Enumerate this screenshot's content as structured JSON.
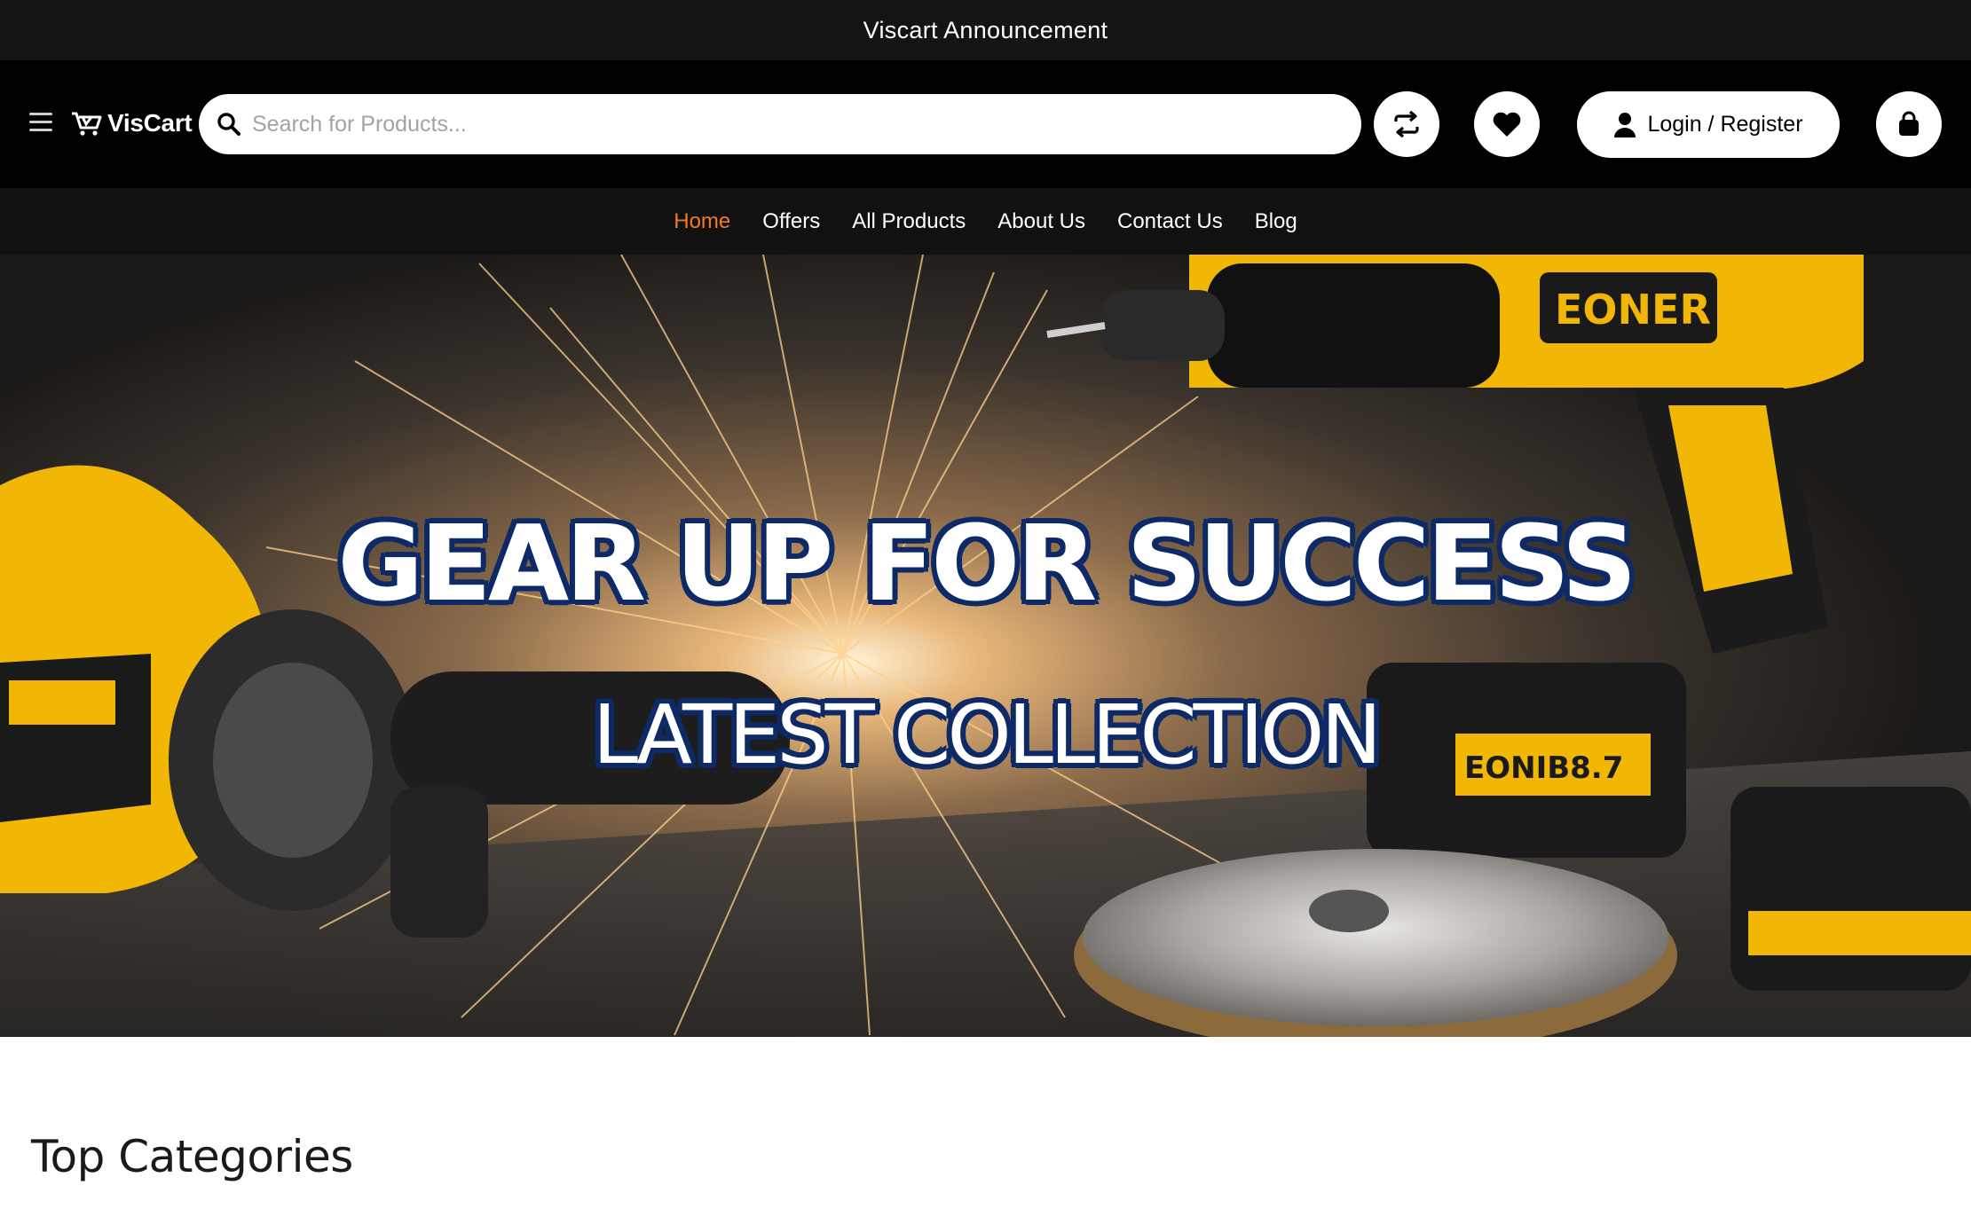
{
  "announcement": {
    "text": "Viscart Announcement"
  },
  "header": {
    "menu_icon": "hamburger-menu-icon",
    "logo": {
      "icon": "cart-logo-icon",
      "name": "VisCart"
    },
    "search": {
      "placeholder": "Search for Products...",
      "value": "",
      "icon": "search-icon"
    },
    "compare_icon": "compare-arrows-icon",
    "wishlist_icon": "heart-icon",
    "login": {
      "icon": "user-icon",
      "label": "Login / Register"
    },
    "cart_icon": "shopping-bag-icon"
  },
  "nav": {
    "items": [
      {
        "label": "Home",
        "active": true
      },
      {
        "label": "Offers",
        "active": false
      },
      {
        "label": "All Products",
        "active": false
      },
      {
        "label": "About Us",
        "active": false
      },
      {
        "label": "Contact Us",
        "active": false
      },
      {
        "label": "Blog",
        "active": false
      }
    ],
    "active_color": "#f07a2a"
  },
  "hero": {
    "title": "GEAR UP FOR SUCCESS",
    "subtitle": "LATEST COLLECTION",
    "outline_color": "#0d2a66",
    "tool_color": "#f2b705",
    "brand_badge": "EONER",
    "battery_label": "EONIB8.7"
  },
  "sections": {
    "top_categories": "Top Categories"
  }
}
